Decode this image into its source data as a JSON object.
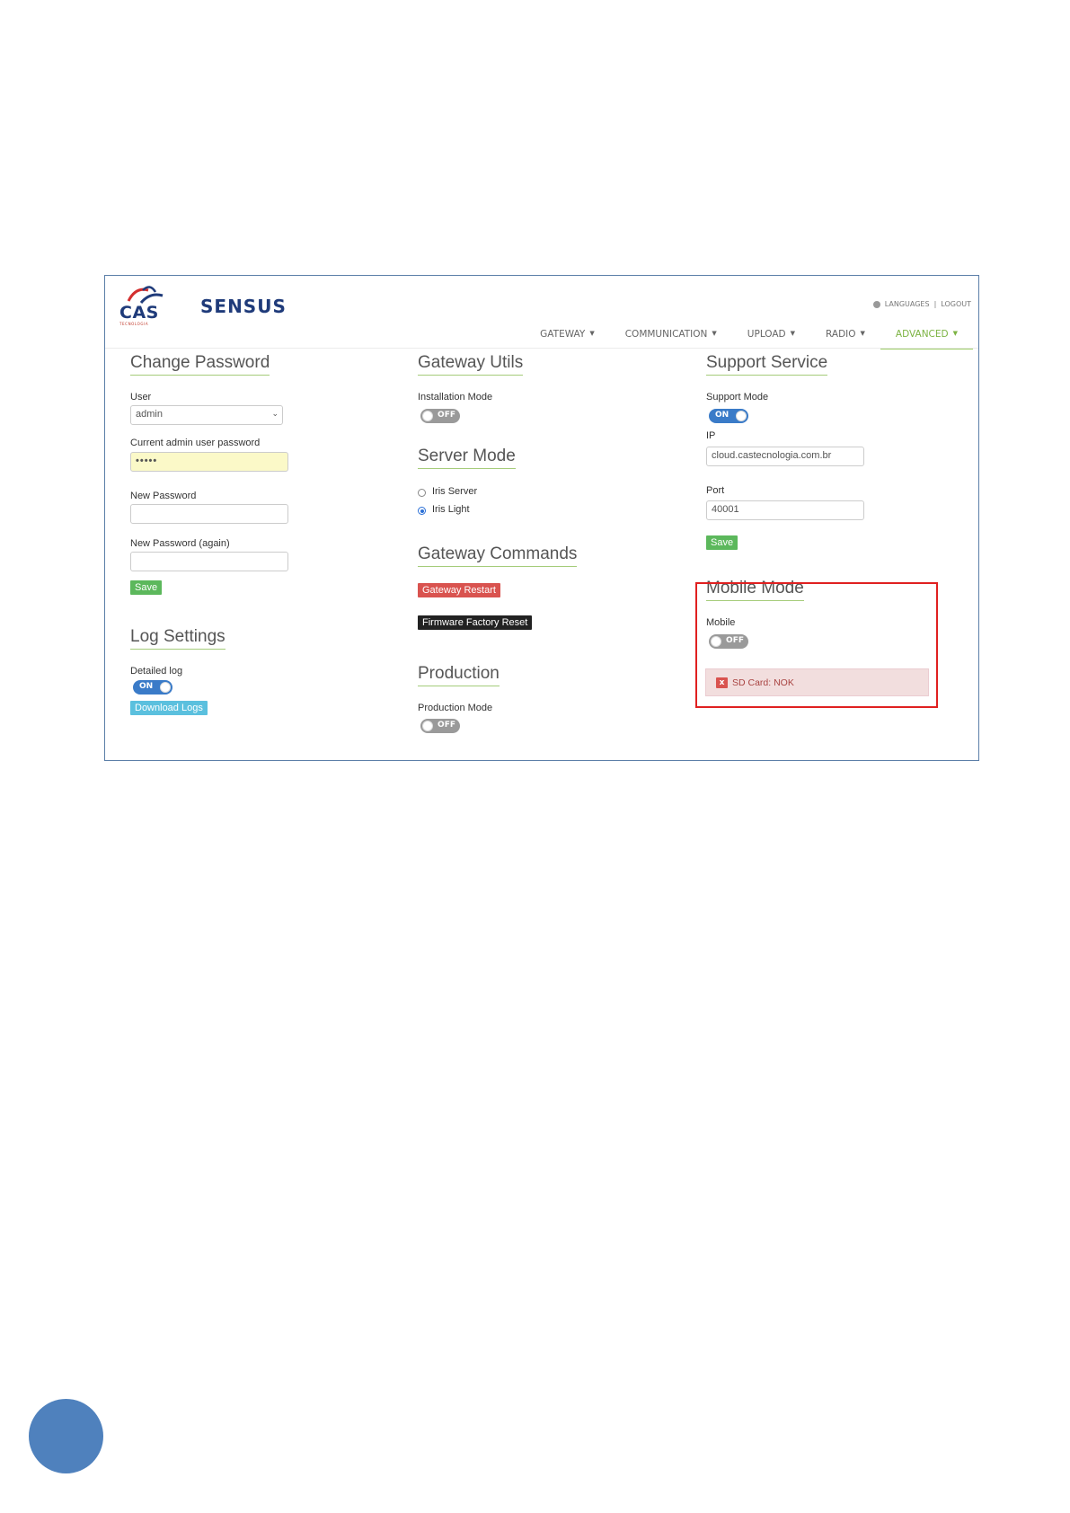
{
  "header": {
    "logo_cas": "CAS",
    "logo_cas_sub": "TECNOLOGIA",
    "logo_sensus": "SENSUS",
    "languages": "LANGUAGES",
    "logout": "LOGOUT"
  },
  "nav": {
    "items": [
      {
        "label": "GATEWAY"
      },
      {
        "label": "COMMUNICATION"
      },
      {
        "label": "UPLOAD"
      },
      {
        "label": "RADIO"
      },
      {
        "label": "ADVANCED"
      }
    ],
    "active": "ADVANCED"
  },
  "change_password": {
    "title": "Change Password",
    "user_label": "User",
    "user_value": "admin",
    "current_label": "Current admin user password",
    "current_value": "•••••",
    "new_label": "New Password",
    "new_again_label": "New Password (again)",
    "save": "Save"
  },
  "log_settings": {
    "title": "Log Settings",
    "detailed_label": "Detailed log",
    "detailed_state": "ON",
    "download": "Download Logs"
  },
  "gateway_utils": {
    "title": "Gateway Utils",
    "installation_label": "Installation Mode",
    "installation_state": "OFF"
  },
  "server_mode": {
    "title": "Server Mode",
    "options": [
      {
        "label": "Iris Server",
        "checked": false
      },
      {
        "label": "Iris Light",
        "checked": true
      }
    ]
  },
  "gateway_commands": {
    "title": "Gateway Commands",
    "restart": "Gateway Restart",
    "factory_reset": "Firmware Factory Reset"
  },
  "production": {
    "title": "Production",
    "mode_label": "Production Mode",
    "mode_state": "OFF"
  },
  "support_service": {
    "title": "Support Service",
    "mode_label": "Support Mode",
    "mode_state": "ON",
    "ip_label": "IP",
    "ip_value": "cloud.castecnologia.com.br",
    "port_label": "Port",
    "port_value": "40001",
    "save": "Save"
  },
  "mobile_mode": {
    "title": "Mobile Mode",
    "mobile_label": "Mobile",
    "mobile_state": "OFF",
    "alert_icon": "x",
    "alert": "SD Card: NOK"
  },
  "colors": {
    "accent_green": "#7cb342",
    "frame_blue": "#5b7ea8",
    "highlight_red": "#e02020",
    "page_circle": "#4f81bd"
  }
}
